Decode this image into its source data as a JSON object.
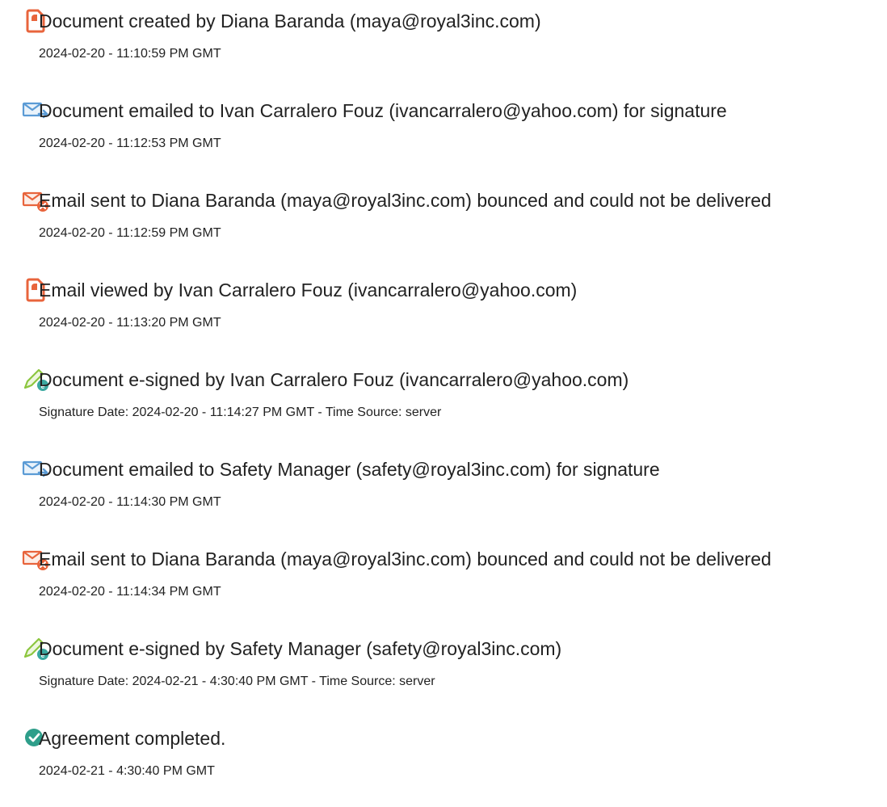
{
  "entries": [
    {
      "icon": "document-created-icon",
      "title": "Document created by Diana Baranda (maya@royal3inc.com)",
      "sub": "2024-02-20 - 11:10:59 PM GMT"
    },
    {
      "icon": "email-sent-icon",
      "title": "Document emailed to Ivan Carralero Fouz (ivancarralero@yahoo.com) for signature",
      "sub": "2024-02-20 - 11:12:53 PM GMT"
    },
    {
      "icon": "email-bounced-icon",
      "title": "Email sent to Diana Baranda (maya@royal3inc.com) bounced and could not be delivered",
      "sub": "2024-02-20 - 11:12:59 PM GMT"
    },
    {
      "icon": "document-viewed-icon",
      "title": "Email viewed by Ivan Carralero Fouz (ivancarralero@yahoo.com)",
      "sub": "2024-02-20 - 11:13:20 PM GMT"
    },
    {
      "icon": "esign-icon",
      "title": "Document e-signed by Ivan Carralero Fouz (ivancarralero@yahoo.com)",
      "sub": "Signature Date: 2024-02-20 - 11:14:27 PM GMT - Time Source: server"
    },
    {
      "icon": "email-sent-icon",
      "title": "Document emailed to Safety Manager (safety@royal3inc.com) for signature",
      "sub": "2024-02-20 - 11:14:30 PM GMT"
    },
    {
      "icon": "email-bounced-icon",
      "title": "Email sent to Diana Baranda (maya@royal3inc.com) bounced and could not be delivered",
      "sub": "2024-02-20 - 11:14:34 PM GMT"
    },
    {
      "icon": "esign-icon",
      "title": "Document e-signed by Safety Manager (safety@royal3inc.com)",
      "sub": "Signature Date: 2024-02-21 - 4:30:40 PM GMT - Time Source: server"
    },
    {
      "icon": "agreement-completed-icon",
      "title": "Agreement completed.",
      "sub": "2024-02-21 - 4:30:40 PM GMT"
    }
  ],
  "colors": {
    "document_icon": "#e8643c",
    "email_icon": "#5b9bd5",
    "bounce_icon": "#e8643c",
    "esign_pen": "#8cc63f",
    "esign_badge": "#3aa8a0",
    "complete_icon": "#2e9e8a"
  }
}
